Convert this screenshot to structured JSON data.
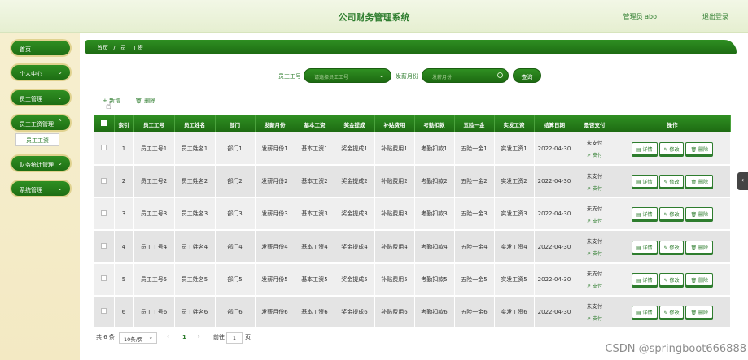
{
  "header": {
    "title": "公司财务管理系统",
    "user": "管理员 abo",
    "logout": "退出登录"
  },
  "sidebar": {
    "items": [
      {
        "label": "首页",
        "chev": ""
      },
      {
        "label": "个人中心",
        "chev": "⌄"
      },
      {
        "label": "员工管理",
        "chev": "⌄"
      },
      {
        "label": "员工工资管理",
        "chev": "⌃"
      },
      {
        "label": "财务统计管理",
        "chev": "⌄"
      },
      {
        "label": "系统管理",
        "chev": "⌄"
      }
    ],
    "sub_item": "员工工资"
  },
  "breadcrumb": {
    "home": "首页",
    "sep": "/",
    "current": "员工工资"
  },
  "search": {
    "emp_label": "员工工号",
    "emp_placeholder": "请选择员工工号",
    "month_label": "发薪月份",
    "month_placeholder": "发薪月份",
    "button": "查询"
  },
  "toolbar": {
    "add": "+ 新增",
    "delete": "🗑 删除"
  },
  "table": {
    "headers": [
      "索引",
      "员工工号",
      "员工姓名",
      "部门",
      "发薪月份",
      "基本工资",
      "奖金提成",
      "补贴费用",
      "考勤扣款",
      "五险一金",
      "实发工资",
      "结算日期",
      "是否支付",
      "操作"
    ],
    "rows": [
      [
        "1",
        "员工工号1",
        "员工姓名1",
        "部门1",
        "发薪月份1",
        "基本工资1",
        "奖金提成1",
        "补贴费用1",
        "考勤扣款1",
        "五险一金1",
        "实发工资1",
        "2022-04-30"
      ],
      [
        "2",
        "员工工号2",
        "员工姓名2",
        "部门2",
        "发薪月份2",
        "基本工资2",
        "奖金提成2",
        "补贴费用2",
        "考勤扣款2",
        "五险一金2",
        "实发工资2",
        "2022-04-30"
      ],
      [
        "3",
        "员工工号3",
        "员工姓名3",
        "部门3",
        "发薪月份3",
        "基本工资3",
        "奖金提成3",
        "补贴费用3",
        "考勤扣款3",
        "五险一金3",
        "实发工资3",
        "2022-04-30"
      ],
      [
        "4",
        "员工工号4",
        "员工姓名4",
        "部门4",
        "发薪月份4",
        "基本工资4",
        "奖金提成4",
        "补贴费用4",
        "考勤扣款4",
        "五险一金4",
        "实发工资4",
        "2022-04-30"
      ],
      [
        "5",
        "员工工号5",
        "员工姓名5",
        "部门5",
        "发薪月份5",
        "基本工资5",
        "奖金提成5",
        "补贴费用5",
        "考勤扣款5",
        "五险一金5",
        "实发工资5",
        "2022-04-30"
      ],
      [
        "6",
        "员工工号6",
        "员工姓名6",
        "部门6",
        "发薪月份6",
        "基本工资6",
        "奖金提成6",
        "补贴费用6",
        "考勤扣款6",
        "五险一金6",
        "实发工资6",
        "2022-04-30"
      ]
    ],
    "pay_status": "未支付",
    "pay_link": "⇗ 支付",
    "actions": {
      "detail": "▤ 详情",
      "edit": "✎ 修改",
      "delete": "🗑 删除"
    }
  },
  "pager": {
    "total": "共 6 条",
    "page_size": "10条/页",
    "prev": "‹",
    "current": "1",
    "next": "›",
    "goto": "前往",
    "goto_value": "1",
    "page_unit": "页"
  },
  "watermark": "CSDN @springboot666888",
  "colors": {
    "primary": "#2e7d2e",
    "header_bg": "#e6efd1",
    "sidebar_bg": "#f3e9c3"
  }
}
